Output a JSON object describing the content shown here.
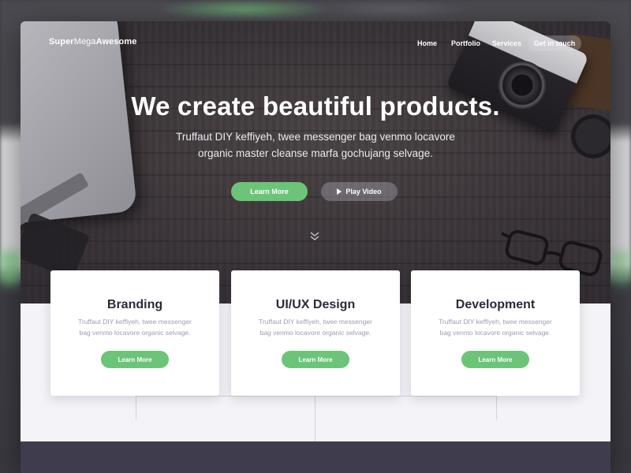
{
  "brand": {
    "bold_part_1": "Super",
    "thin_part": "Mega",
    "bold_part_2": "Awesome"
  },
  "nav": {
    "links": [
      "Home",
      "Portfolio",
      "Services"
    ],
    "cta": "Get in touch"
  },
  "hero": {
    "title": "We create beautiful products.",
    "subtitle_line_1": "Truffaut DIY keffiyeh, twee messenger bag venmo locavore",
    "subtitle_line_2": "organic master cleanse marfa gochujang selvage.",
    "primary_button": "Learn More",
    "secondary_button": "Play Video",
    "scroll_icon": "chevron-double-down-icon"
  },
  "cards": [
    {
      "title": "Branding",
      "text_line_1": "Truffaut DIY keffiyeh, twee messenger",
      "text_line_2": "bag venmo locavore organic selvage.",
      "button": "Learn More"
    },
    {
      "title": "UI/UX Design",
      "text_line_1": "Truffaut DIY keffiyeh, twee messenger",
      "text_line_2": "bag venmo locavore organic selvage.",
      "button": "Learn More"
    },
    {
      "title": "Development",
      "text_line_1": "Truffaut DIY keffiyeh, twee messenger",
      "text_line_2": "bag venmo locavore organic selvage.",
      "button": "Learn More"
    }
  ],
  "colors": {
    "accent_green": "#6cc478",
    "heading_dark": "#2c2a3a",
    "body_muted": "#9e9cb0",
    "footer_dark": "#3f3d4d",
    "section_bg": "#f4f3f7"
  }
}
